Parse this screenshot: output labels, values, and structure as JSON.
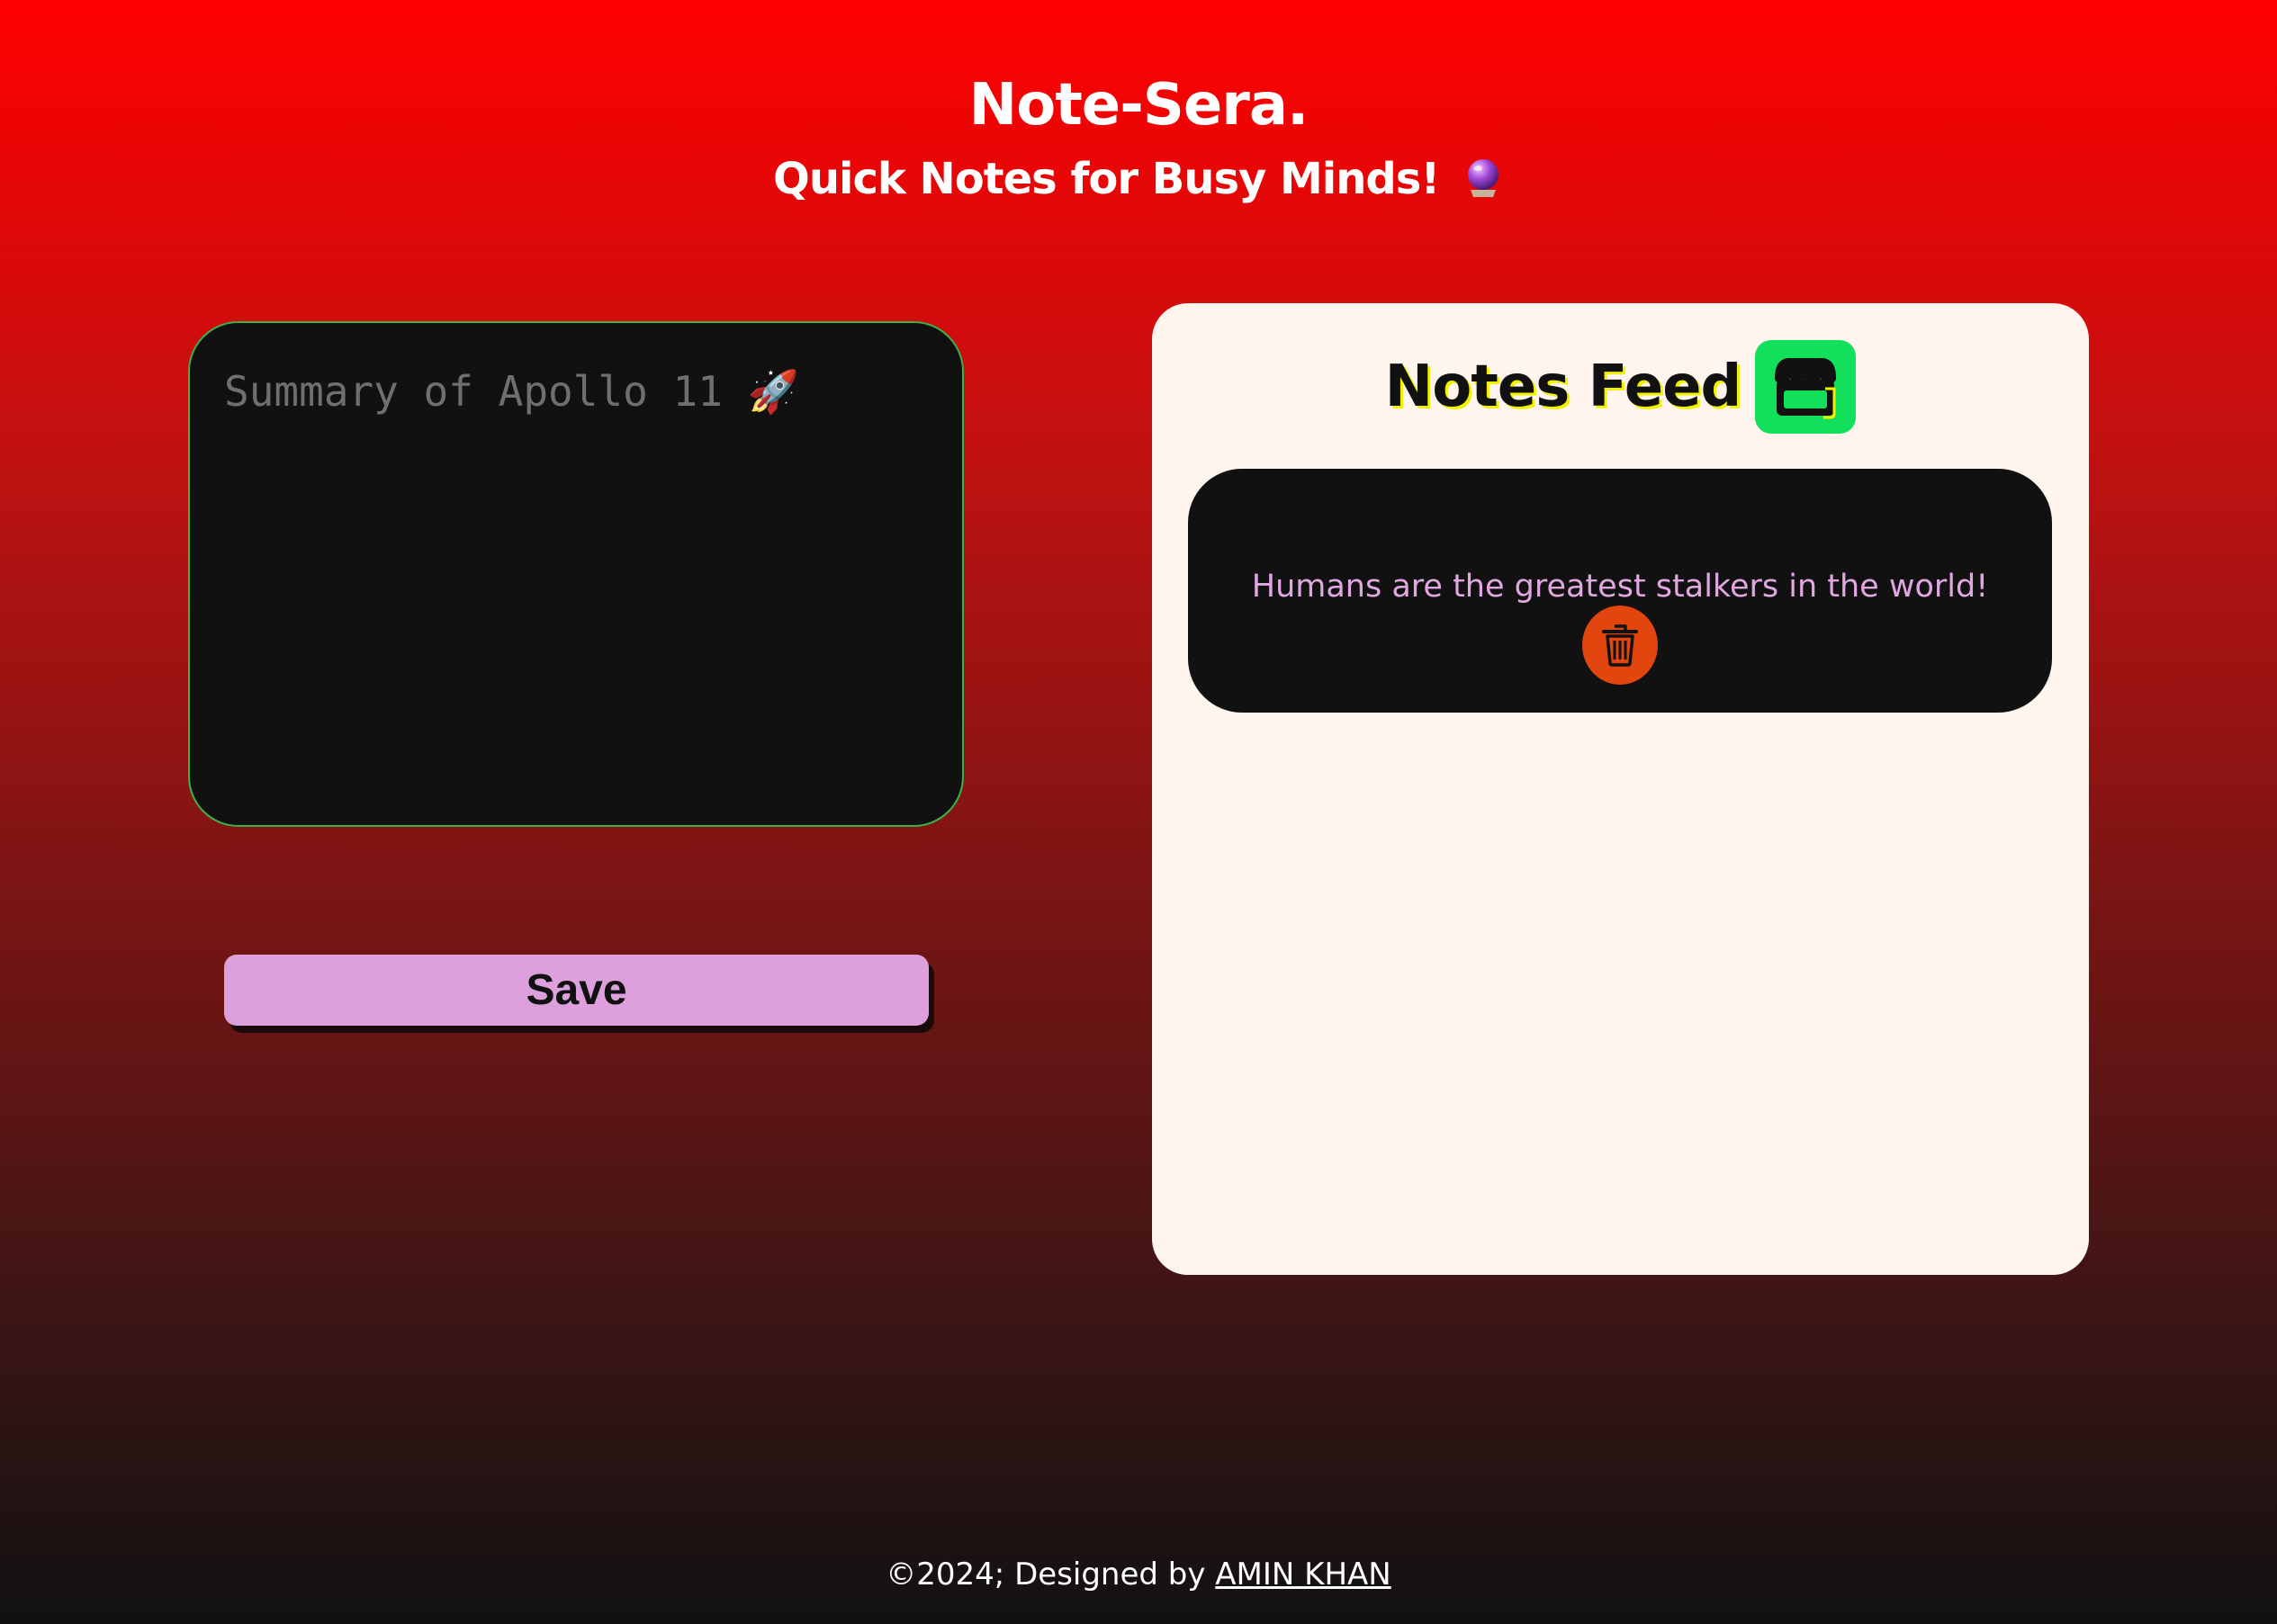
{
  "header": {
    "title": "Note-Sera.",
    "subtitle": "Quick Notes for Busy Minds!",
    "subtitle_icon": "crystal-ball-icon"
  },
  "editor": {
    "placeholder": "Summary of Apollo 11 🚀",
    "value": ""
  },
  "actions": {
    "save_label": "Save"
  },
  "feed": {
    "title": "Notes Feed",
    "title_icon": "store-icon",
    "notes": [
      {
        "text": "Humans are the greatest stalkers in the world!",
        "action_icon": "trash-icon"
      }
    ]
  },
  "footer": {
    "text": "©2024; Designed by",
    "author_link": "AMIN KHAN"
  },
  "colors": {
    "background_top": "#ff0000",
    "background_bottom": "#111111",
    "input_border": "#3ab24a",
    "save_button": "#dea0dc",
    "feed_background": "#fff4ee",
    "note_text": "#e0a7e0",
    "delete_button": "#e2460e",
    "store_icon_bg": "#12e05a"
  }
}
